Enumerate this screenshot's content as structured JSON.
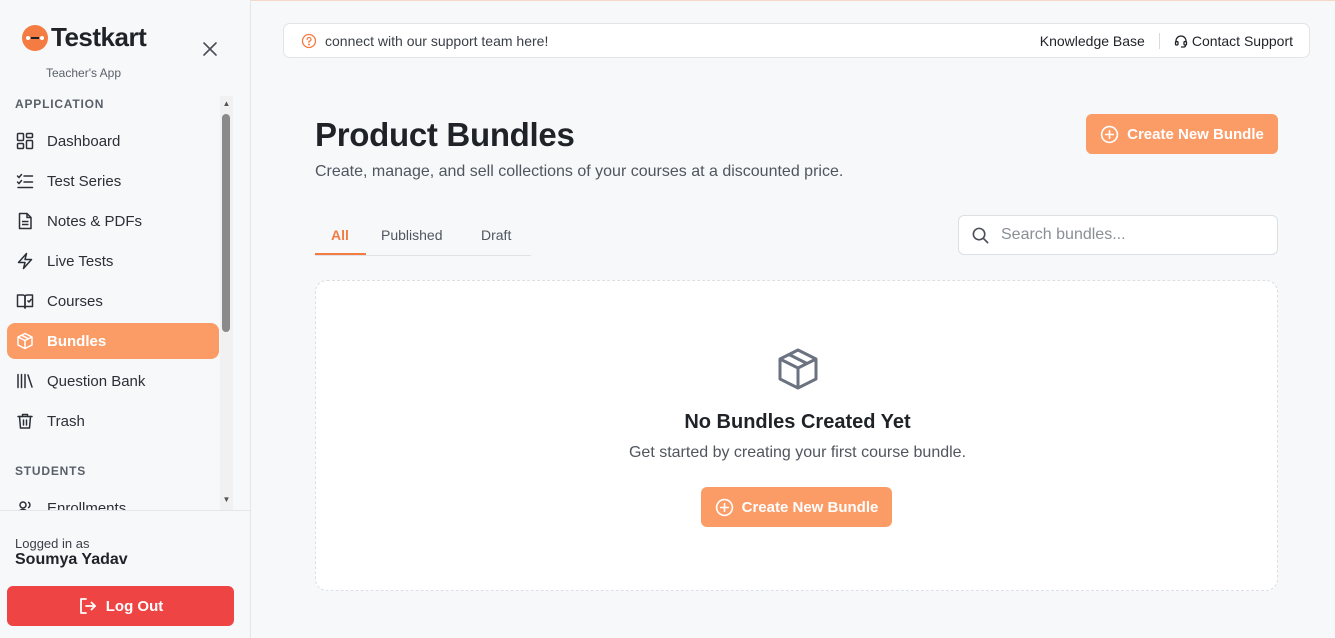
{
  "brand": {
    "name": "Testkart",
    "subtitle": "Teacher's App",
    "accent": "#f47c42"
  },
  "sidebar": {
    "sections": [
      {
        "label": "APPLICATION"
      },
      {
        "label": "STUDENTS"
      }
    ],
    "items": [
      {
        "label": "Dashboard",
        "icon": "dashboard-icon"
      },
      {
        "label": "Test Series",
        "icon": "checklist-icon"
      },
      {
        "label": "Notes & PDFs",
        "icon": "document-icon"
      },
      {
        "label": "Live Tests",
        "icon": "lightning-icon"
      },
      {
        "label": "Courses",
        "icon": "book-icon"
      },
      {
        "label": "Bundles",
        "icon": "package-icon",
        "active": true
      },
      {
        "label": "Question Bank",
        "icon": "library-icon"
      },
      {
        "label": "Trash",
        "icon": "trash-icon"
      },
      {
        "label": "Enrollments",
        "icon": "users-icon"
      }
    ],
    "logged_in_label": "Logged in as",
    "user_name": "Soumya Yadav",
    "logout_label": "Log Out",
    "logout_color": "#ef4444"
  },
  "support_bar": {
    "text": "connect with our support team here!",
    "knowledge_base": "Knowledge Base",
    "contact_support": "Contact Support"
  },
  "main": {
    "title": "Product Bundles",
    "subtitle": "Create, manage, and sell collections of your courses at a discounted price.",
    "create_button": "Create New Bundle",
    "tabs": [
      {
        "label": "All",
        "active": true
      },
      {
        "label": "Published"
      },
      {
        "label": "Draft"
      }
    ],
    "search": {
      "placeholder": "Search bundles...",
      "value": ""
    },
    "empty_state": {
      "title": "No Bundles Created Yet",
      "description": "Get started by creating your first course bundle.",
      "button": "Create New Bundle"
    }
  }
}
